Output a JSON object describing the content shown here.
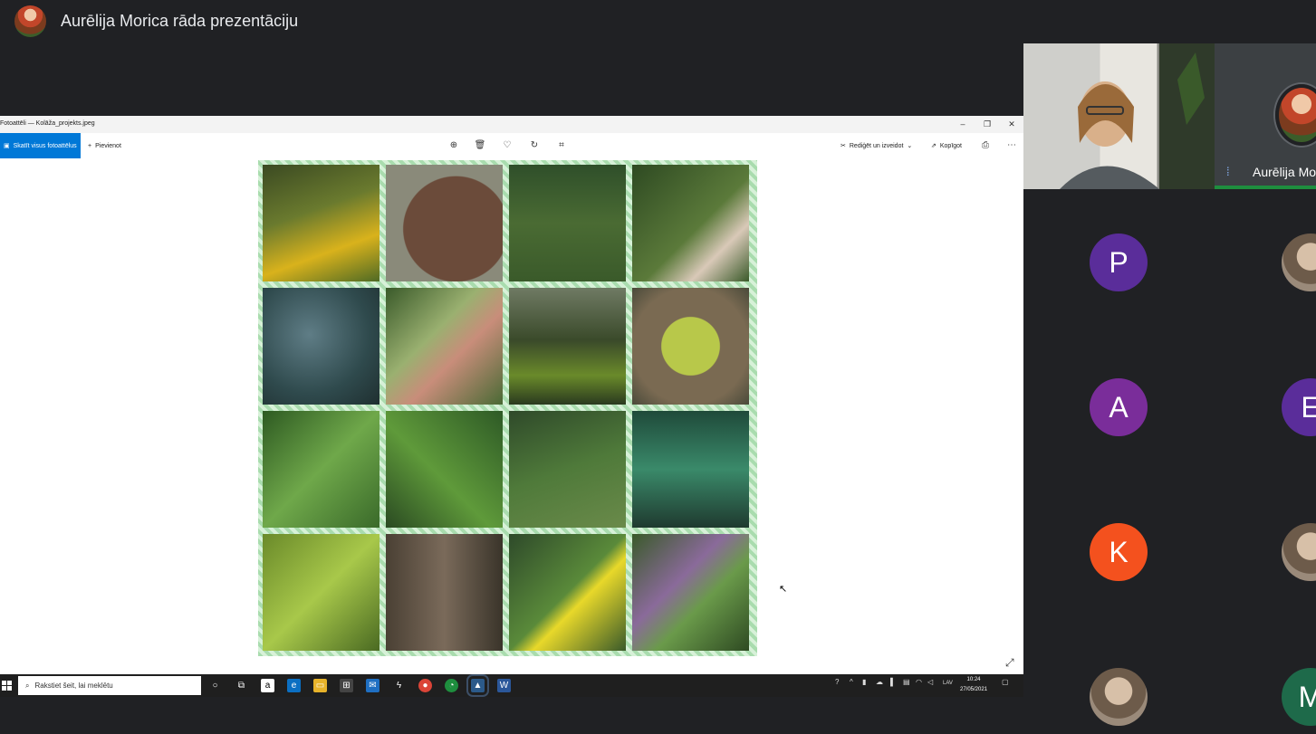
{
  "presenter": {
    "title": "Aurēlija Morica rāda prezentāciju"
  },
  "app": {
    "window_title": "Fotoattēli — Kolāža_projekts.jpeg",
    "view_all_label": "Skatīt visus fotoattēlus",
    "add_label": "Pievienot",
    "edit_label": "Rediģēt un izveidot",
    "share_label": "Kopīgot"
  },
  "collage": {
    "tiles": [
      {
        "bg": "linear-gradient(160deg,#3b4a22,#6a7a2e 40%,#d9b21c 70%,#4f6a24)"
      },
      {
        "bg": "radial-gradient(circle at 60% 55%,#6b4b3a 0 55%,#8a8a7a 56%)"
      },
      {
        "bg": "linear-gradient(180deg,#2f4f2a,#4a6b33 50%,#3a5a2a)"
      },
      {
        "bg": "linear-gradient(135deg,#2e4a22,#5b7a3a 55%,#d9c9b8 75%,#3a5a2a)"
      },
      {
        "bg": "radial-gradient(circle at 40% 40%,#5f7d86,#2f4a4d 60%,#1f2f30)"
      },
      {
        "bg": "linear-gradient(135deg,#3a5a2a,#9ab070 40%,#c88d7a 60%,#4a6a35)"
      },
      {
        "bg": "linear-gradient(180deg,#6f7a64,#3a4a2a 45%,#6a8a2a 75%,#2a3a1f)"
      },
      {
        "bg": "radial-gradient(circle at 50% 50%,#b8c84a 0 35%,#7a6a52 36% 70%,#4a4a3a)"
      },
      {
        "bg": "linear-gradient(135deg,#2e5a22,#6fa84a 50%,#3a6a2a)"
      },
      {
        "bg": "linear-gradient(45deg,#2a4a22,#5f9a3a 45%,#2e5a26)"
      },
      {
        "bg": "linear-gradient(160deg,#2f4a2a,#4f7a3a 50%,#6a8a4a)"
      },
      {
        "bg": "linear-gradient(180deg,#1f4a3a,#3a8a6a 50%,#1f3a2f)"
      },
      {
        "bg": "linear-gradient(135deg,#6a8a2a,#a8c84a 50%,#4a6a22)"
      },
      {
        "bg": "linear-gradient(90deg,#4a4034,#7a6a5a 50%,#3a342a)"
      },
      {
        "bg": "linear-gradient(135deg,#2e4a2a,#5a8a3a 50%,#e8d82a 60%,#3a5a2a)"
      },
      {
        "bg": "linear-gradient(135deg,#3a5a2a,#8a6a9a 40%,#6a9a4a 60%,#2e4a22)"
      }
    ]
  },
  "taskbar": {
    "search_placeholder": "Rakstiet šeit, lai meklētu",
    "lang": "LAV",
    "time": "10:24",
    "date": "27/05/2021"
  },
  "participants": {
    "speaker_name": "Aurēlija Mo",
    "avatars": [
      {
        "letter": "P",
        "color": "#5a2d9a"
      },
      {
        "letter": "",
        "color": "photo"
      },
      {
        "letter": "A",
        "color": "#7a2d9a"
      },
      {
        "letter": "E",
        "color": "#5a2d9a"
      },
      {
        "letter": "K",
        "color": "#f4511e"
      },
      {
        "letter": "",
        "color": "photo"
      },
      {
        "letter": "",
        "color": "photo"
      },
      {
        "letter": "M",
        "color": "#1e6a4a"
      }
    ]
  }
}
